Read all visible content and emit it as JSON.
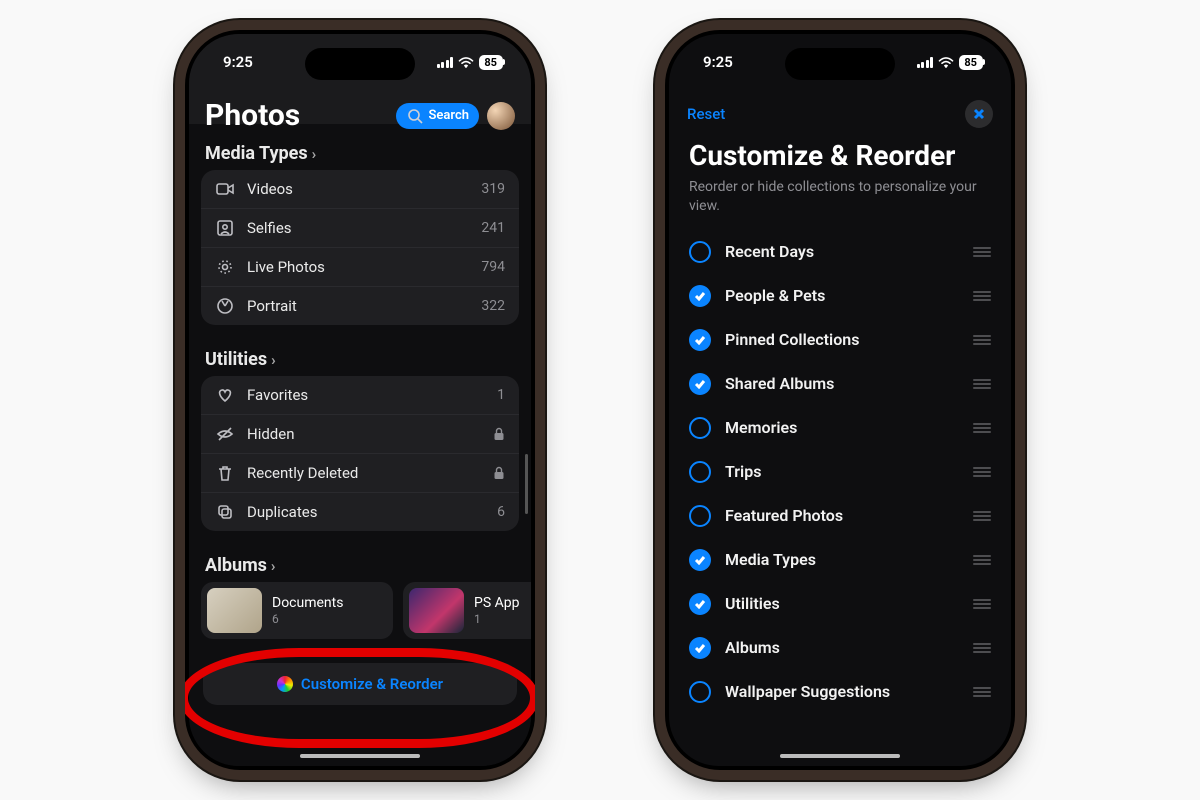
{
  "status": {
    "time": "9:25",
    "battery": "85"
  },
  "phone1": {
    "title": "Photos",
    "search_label": "Search",
    "sections": {
      "media_types": {
        "heading": "Media Types",
        "items": [
          {
            "icon": "video-icon",
            "label": "Videos",
            "count": "319"
          },
          {
            "icon": "selfie-icon",
            "label": "Selfies",
            "count": "241"
          },
          {
            "icon": "live-icon",
            "label": "Live Photos",
            "count": "794"
          },
          {
            "icon": "portrait-icon",
            "label": "Portrait",
            "count": "322"
          }
        ]
      },
      "utilities": {
        "heading": "Utilities",
        "items": [
          {
            "icon": "heart-icon",
            "label": "Favorites",
            "count": "1",
            "locked": false
          },
          {
            "icon": "hidden-icon",
            "label": "Hidden",
            "count": "",
            "locked": true
          },
          {
            "icon": "trash-icon",
            "label": "Recently Deleted",
            "count": "",
            "locked": true
          },
          {
            "icon": "dup-icon",
            "label": "Duplicates",
            "count": "6",
            "locked": false
          }
        ]
      },
      "albums": {
        "heading": "Albums",
        "items": [
          {
            "label": "Documents",
            "count": "6"
          },
          {
            "label": "PS App",
            "count": "1"
          }
        ]
      }
    },
    "customize_button": "Customize & Reorder"
  },
  "phone2": {
    "reset": "Reset",
    "title": "Customize & Reorder",
    "description": "Reorder or hide collections to personalize your view.",
    "items": [
      {
        "label": "Recent Days",
        "checked": false
      },
      {
        "label": "People & Pets",
        "checked": true
      },
      {
        "label": "Pinned Collections",
        "checked": true
      },
      {
        "label": "Shared Albums",
        "checked": true
      },
      {
        "label": "Memories",
        "checked": false
      },
      {
        "label": "Trips",
        "checked": false
      },
      {
        "label": "Featured Photos",
        "checked": false
      },
      {
        "label": "Media Types",
        "checked": true
      },
      {
        "label": "Utilities",
        "checked": true
      },
      {
        "label": "Albums",
        "checked": true
      },
      {
        "label": "Wallpaper Suggestions",
        "checked": false
      }
    ]
  }
}
